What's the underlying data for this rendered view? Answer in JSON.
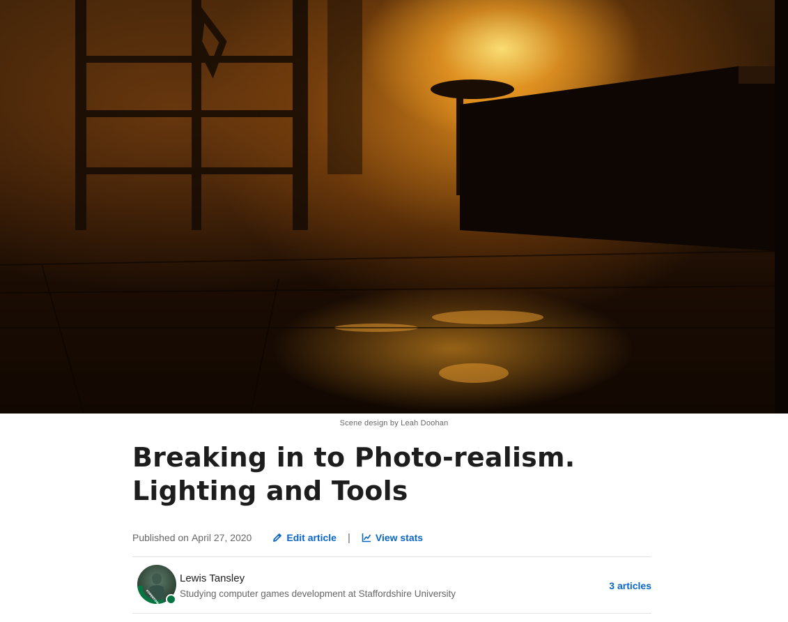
{
  "hero": {
    "caption": "Scene design by Leah Doohan"
  },
  "article": {
    "title": "Breaking in to Photo-realism. Lighting and Tools",
    "published_prefix": "Published on",
    "published_date": "April 27, 2020",
    "edit_label": "Edit article",
    "stats_label": "View stats",
    "separator": "|"
  },
  "author": {
    "name": "Lewis Tansley",
    "headline": "Studying computer games development at Staffordshire University",
    "articles_label": "3 articles",
    "avatar_badge_text": "#OPENTOWORK",
    "status": "online"
  },
  "colors": {
    "link": "#0a66c2",
    "muted": "#666666",
    "online": "#057642",
    "open_to_work": "#057642"
  },
  "icons": {
    "edit": "pencil-icon",
    "stats": "line-chart-icon"
  }
}
